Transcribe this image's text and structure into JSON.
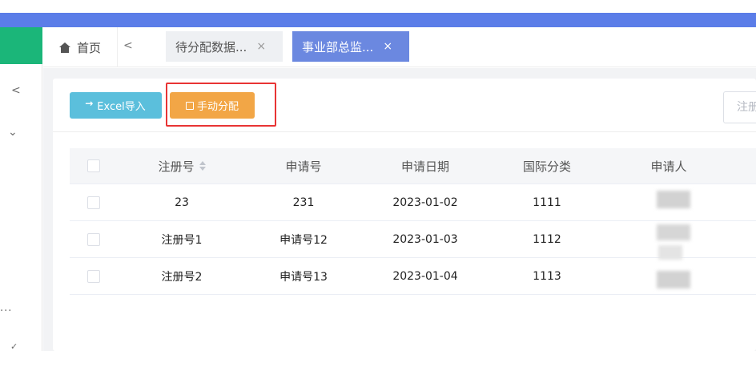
{
  "tabs": {
    "home_label": "首页",
    "prev_glyph": "<",
    "items": [
      {
        "label": "待分配数据...",
        "close": "×",
        "active": false
      },
      {
        "label": "事业部总监...",
        "close": "×",
        "active": true
      }
    ]
  },
  "toolbar": {
    "import_label": "Excel导入",
    "manual_label": "手动分配",
    "search_placeholder": "注册"
  },
  "table": {
    "columns": [
      "注册号",
      "申请号",
      "申请日期",
      "国际分类",
      "申请人"
    ],
    "rows": [
      {
        "reg": "23",
        "app": "231",
        "date": "2023-01-02",
        "cls": "1111"
      },
      {
        "reg": "注册号1",
        "app": "申请号12",
        "date": "2023-01-03",
        "cls": "1112"
      },
      {
        "reg": "注册号2",
        "app": "申请号13",
        "date": "2023-01-04",
        "cls": "1113"
      }
    ]
  },
  "sidebar": {
    "collapse_glyph": "<",
    "expand_glyph": "⌄",
    "more_glyph": "...",
    "tick_glyph": "✓"
  },
  "colors": {
    "top_bar": "#5b7de8",
    "brand": "#1bb679",
    "active_tab": "#6b88e0",
    "import_button": "#5bbfdc",
    "manual_button": "#f2a646",
    "highlight": "#e83434"
  }
}
